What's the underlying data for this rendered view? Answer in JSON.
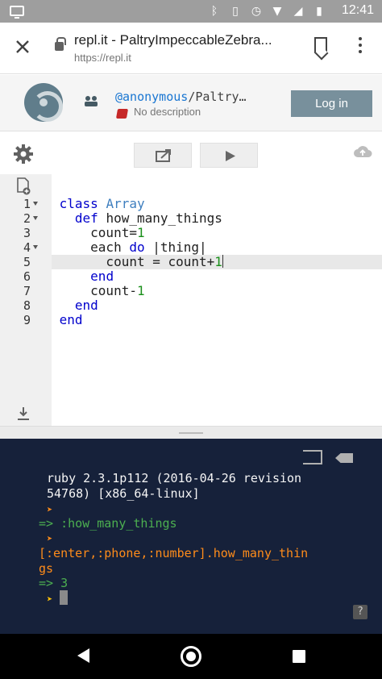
{
  "status_bar": {
    "time": "12:41"
  },
  "browser": {
    "title": "repl.it - PaltryImpeccableZebra...",
    "url": "https://repl.it"
  },
  "repl_header": {
    "user_at": "@anonymous",
    "repl_name": "/Paltry…",
    "description": "No description",
    "login_label": "Log in"
  },
  "editor": {
    "line_numbers": [
      "1",
      "2",
      "3",
      "4",
      "5",
      "6",
      "7",
      "8",
      "9"
    ],
    "active_line": 5
  },
  "console": {
    "banner_line1": "ruby 2.3.1p112 (2016-04-26 revision",
    "banner_line2": "54768) [x86_64-linux]",
    "result1": "=> :how_many_things",
    "input2_line1": "[:enter,:phone,:number].how_many_thin",
    "input2_line2": "gs",
    "result2_arrow": "=> ",
    "result2_value": "3",
    "help_label": "?"
  },
  "colors": {
    "keyword": "#0000cc",
    "class_name": "#3f7fbf",
    "number": "#1a8f1a",
    "console_bg": "#16213a",
    "console_green": "#4caf50",
    "console_orange": "#ff8c1a",
    "login_button": "#78909c"
  }
}
